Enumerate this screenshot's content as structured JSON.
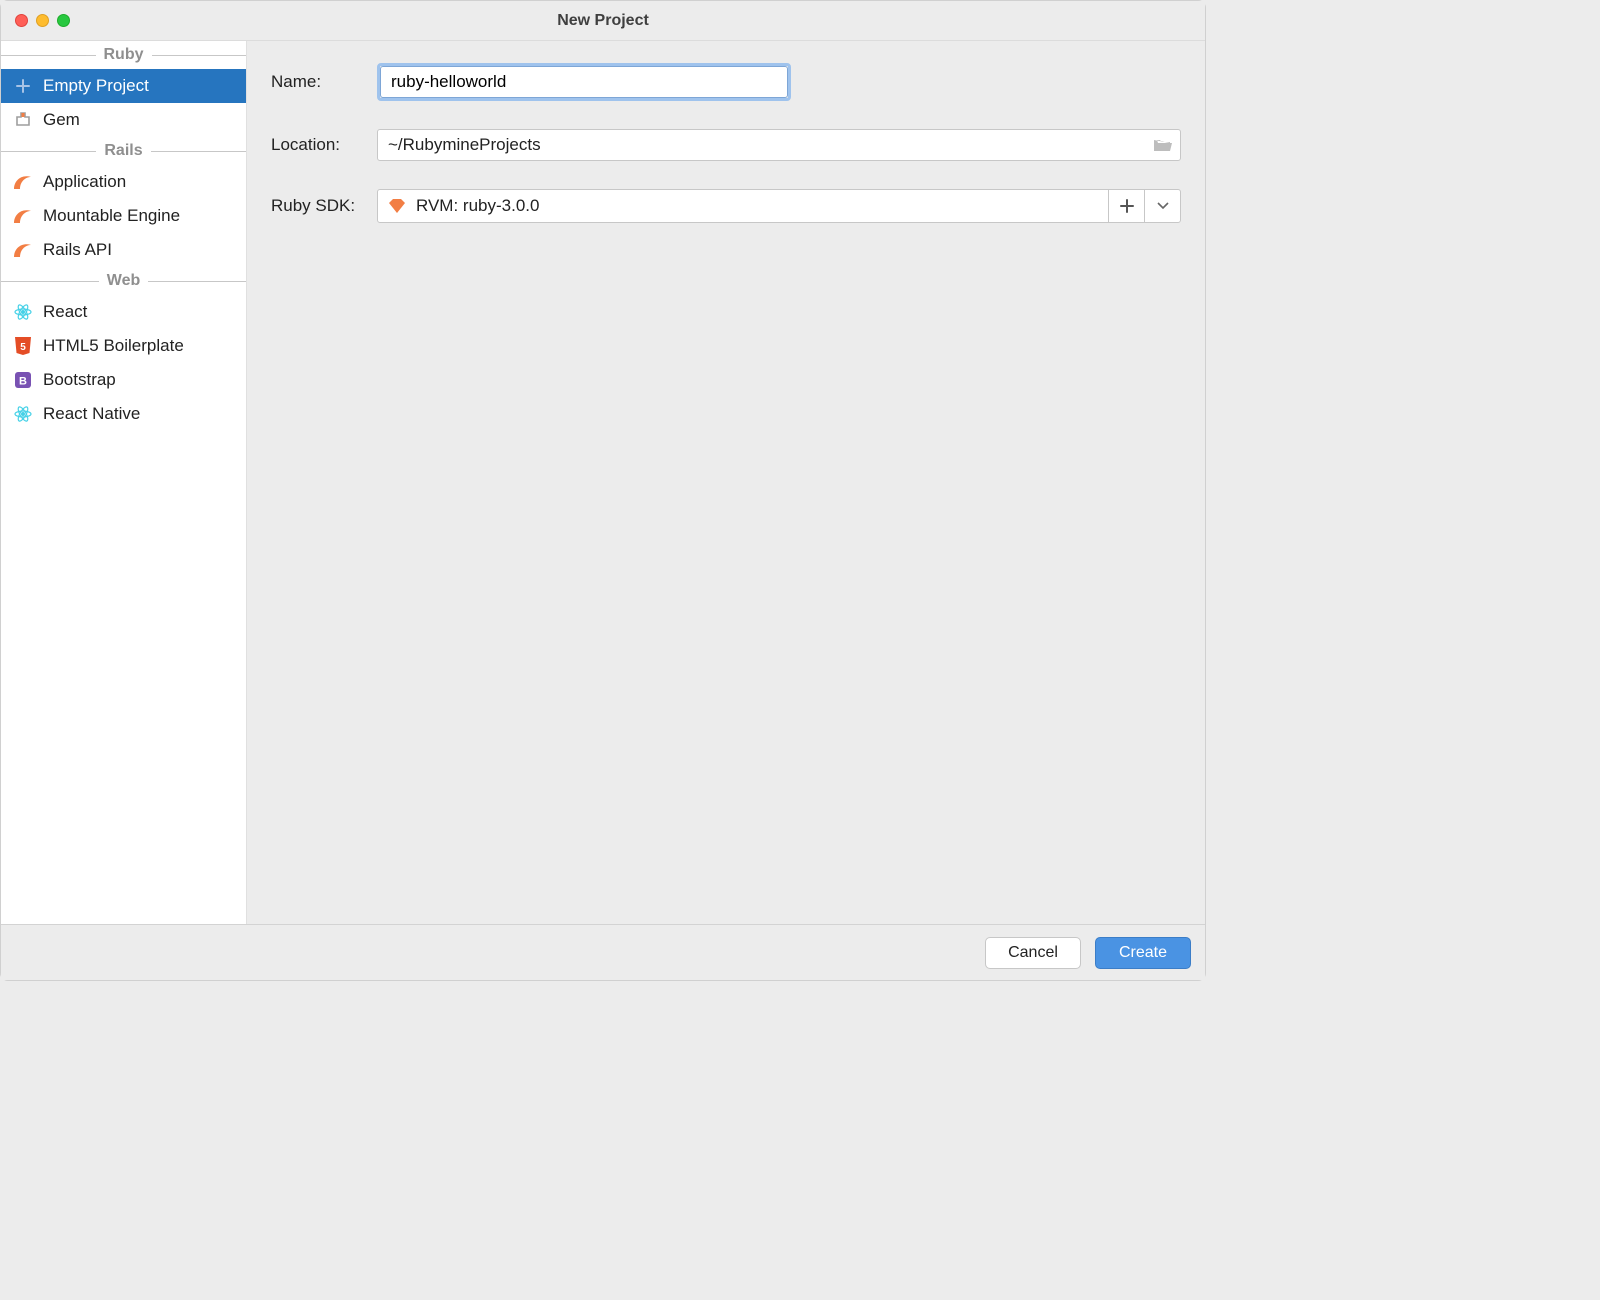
{
  "window": {
    "title": "New Project"
  },
  "sidebar": {
    "groups": [
      {
        "label": "Ruby",
        "items": [
          {
            "label": "Empty Project",
            "icon": "plus-icon",
            "selected": true
          },
          {
            "label": "Gem",
            "icon": "gem-icon",
            "selected": false
          }
        ]
      },
      {
        "label": "Rails",
        "items": [
          {
            "label": "Application",
            "icon": "rails-icon",
            "selected": false
          },
          {
            "label": "Mountable Engine",
            "icon": "rails-icon",
            "selected": false
          },
          {
            "label": "Rails API",
            "icon": "rails-icon",
            "selected": false
          }
        ]
      },
      {
        "label": "Web",
        "items": [
          {
            "label": "React",
            "icon": "react-icon",
            "selected": false
          },
          {
            "label": "HTML5 Boilerplate",
            "icon": "html5-icon",
            "selected": false
          },
          {
            "label": "Bootstrap",
            "icon": "bootstrap-icon",
            "selected": false
          },
          {
            "label": "React Native",
            "icon": "react-icon",
            "selected": false
          }
        ]
      }
    ]
  },
  "form": {
    "name_label": "Name:",
    "name_value": "ruby-helloworld",
    "location_label": "Location:",
    "location_value": "~/RubymineProjects",
    "sdk_label": "Ruby SDK:",
    "sdk_value": "RVM: ruby-3.0.0"
  },
  "footer": {
    "cancel": "Cancel",
    "create": "Create"
  },
  "colors": {
    "primary": "#4a93e3",
    "selection": "#2675BF",
    "orange": "#f27e44",
    "cyan": "#46d1e7",
    "html5": "#e44d26",
    "bootstrap": "#7952b3"
  }
}
